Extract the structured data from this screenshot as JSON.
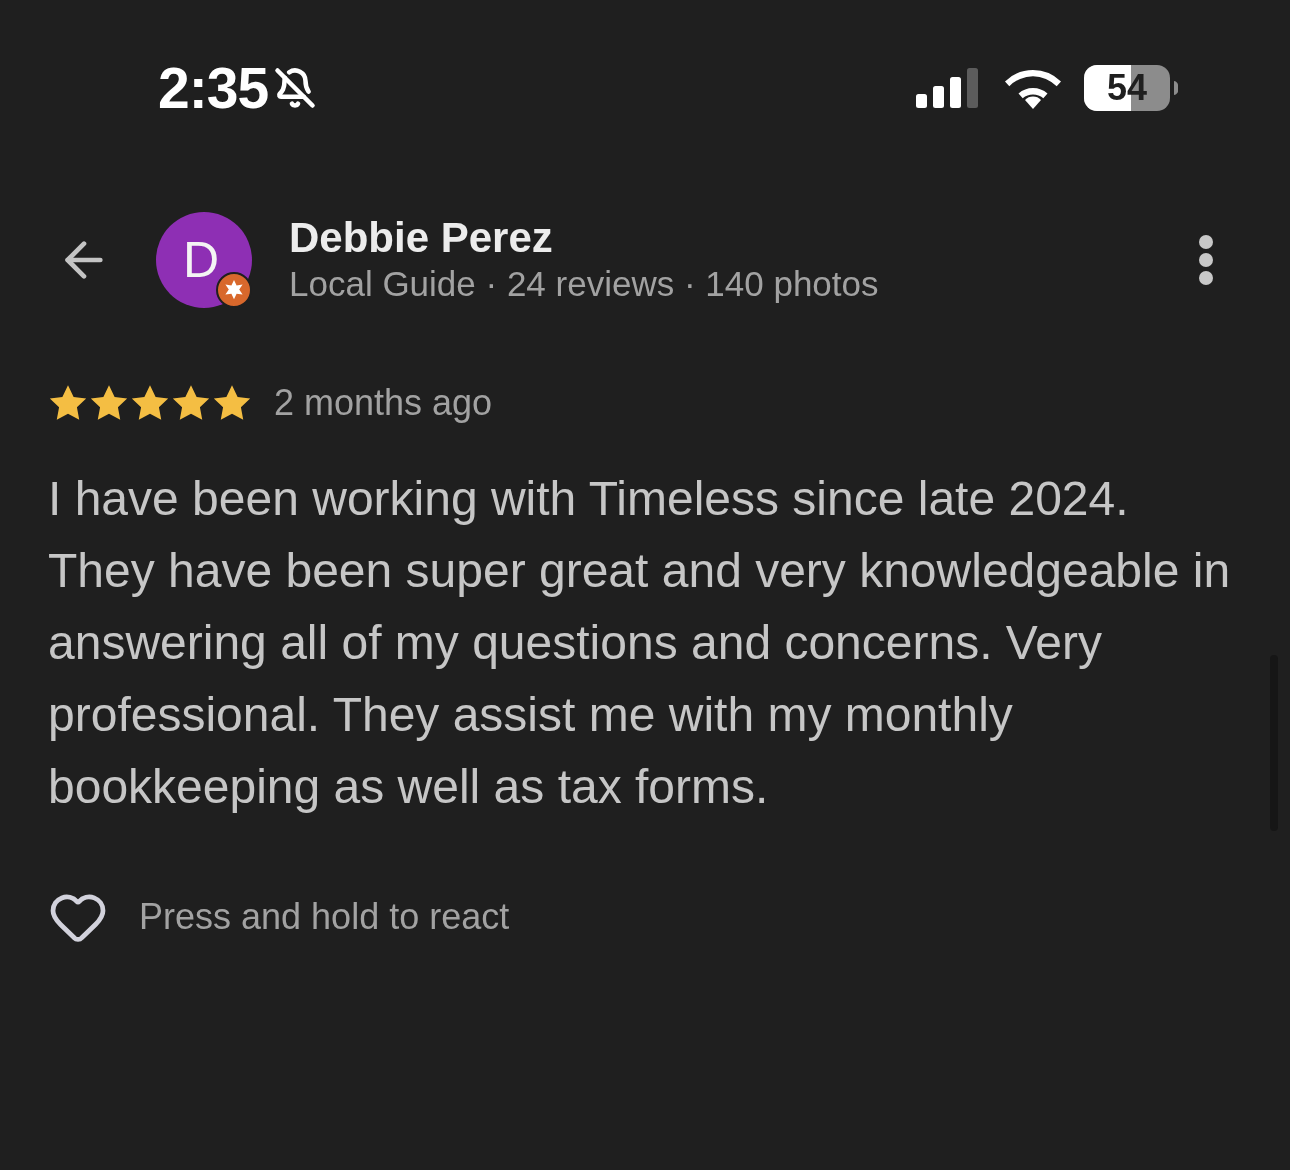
{
  "status_bar": {
    "time": "2:35",
    "battery": "54"
  },
  "header": {
    "avatar_letter": "D",
    "name": "Debbie Perez",
    "subtitle": "Local Guide · 24 reviews · 140 photos"
  },
  "review": {
    "stars": 5,
    "time": "2 months ago",
    "text": "I have been working with Timeless since late 2024. They have been super great and very knowledgeable in answering all of my questions and concerns. Very professional. They assist me with my monthly bookkeeping as well as tax forms."
  },
  "reaction": {
    "hint": "Press and hold to react"
  }
}
